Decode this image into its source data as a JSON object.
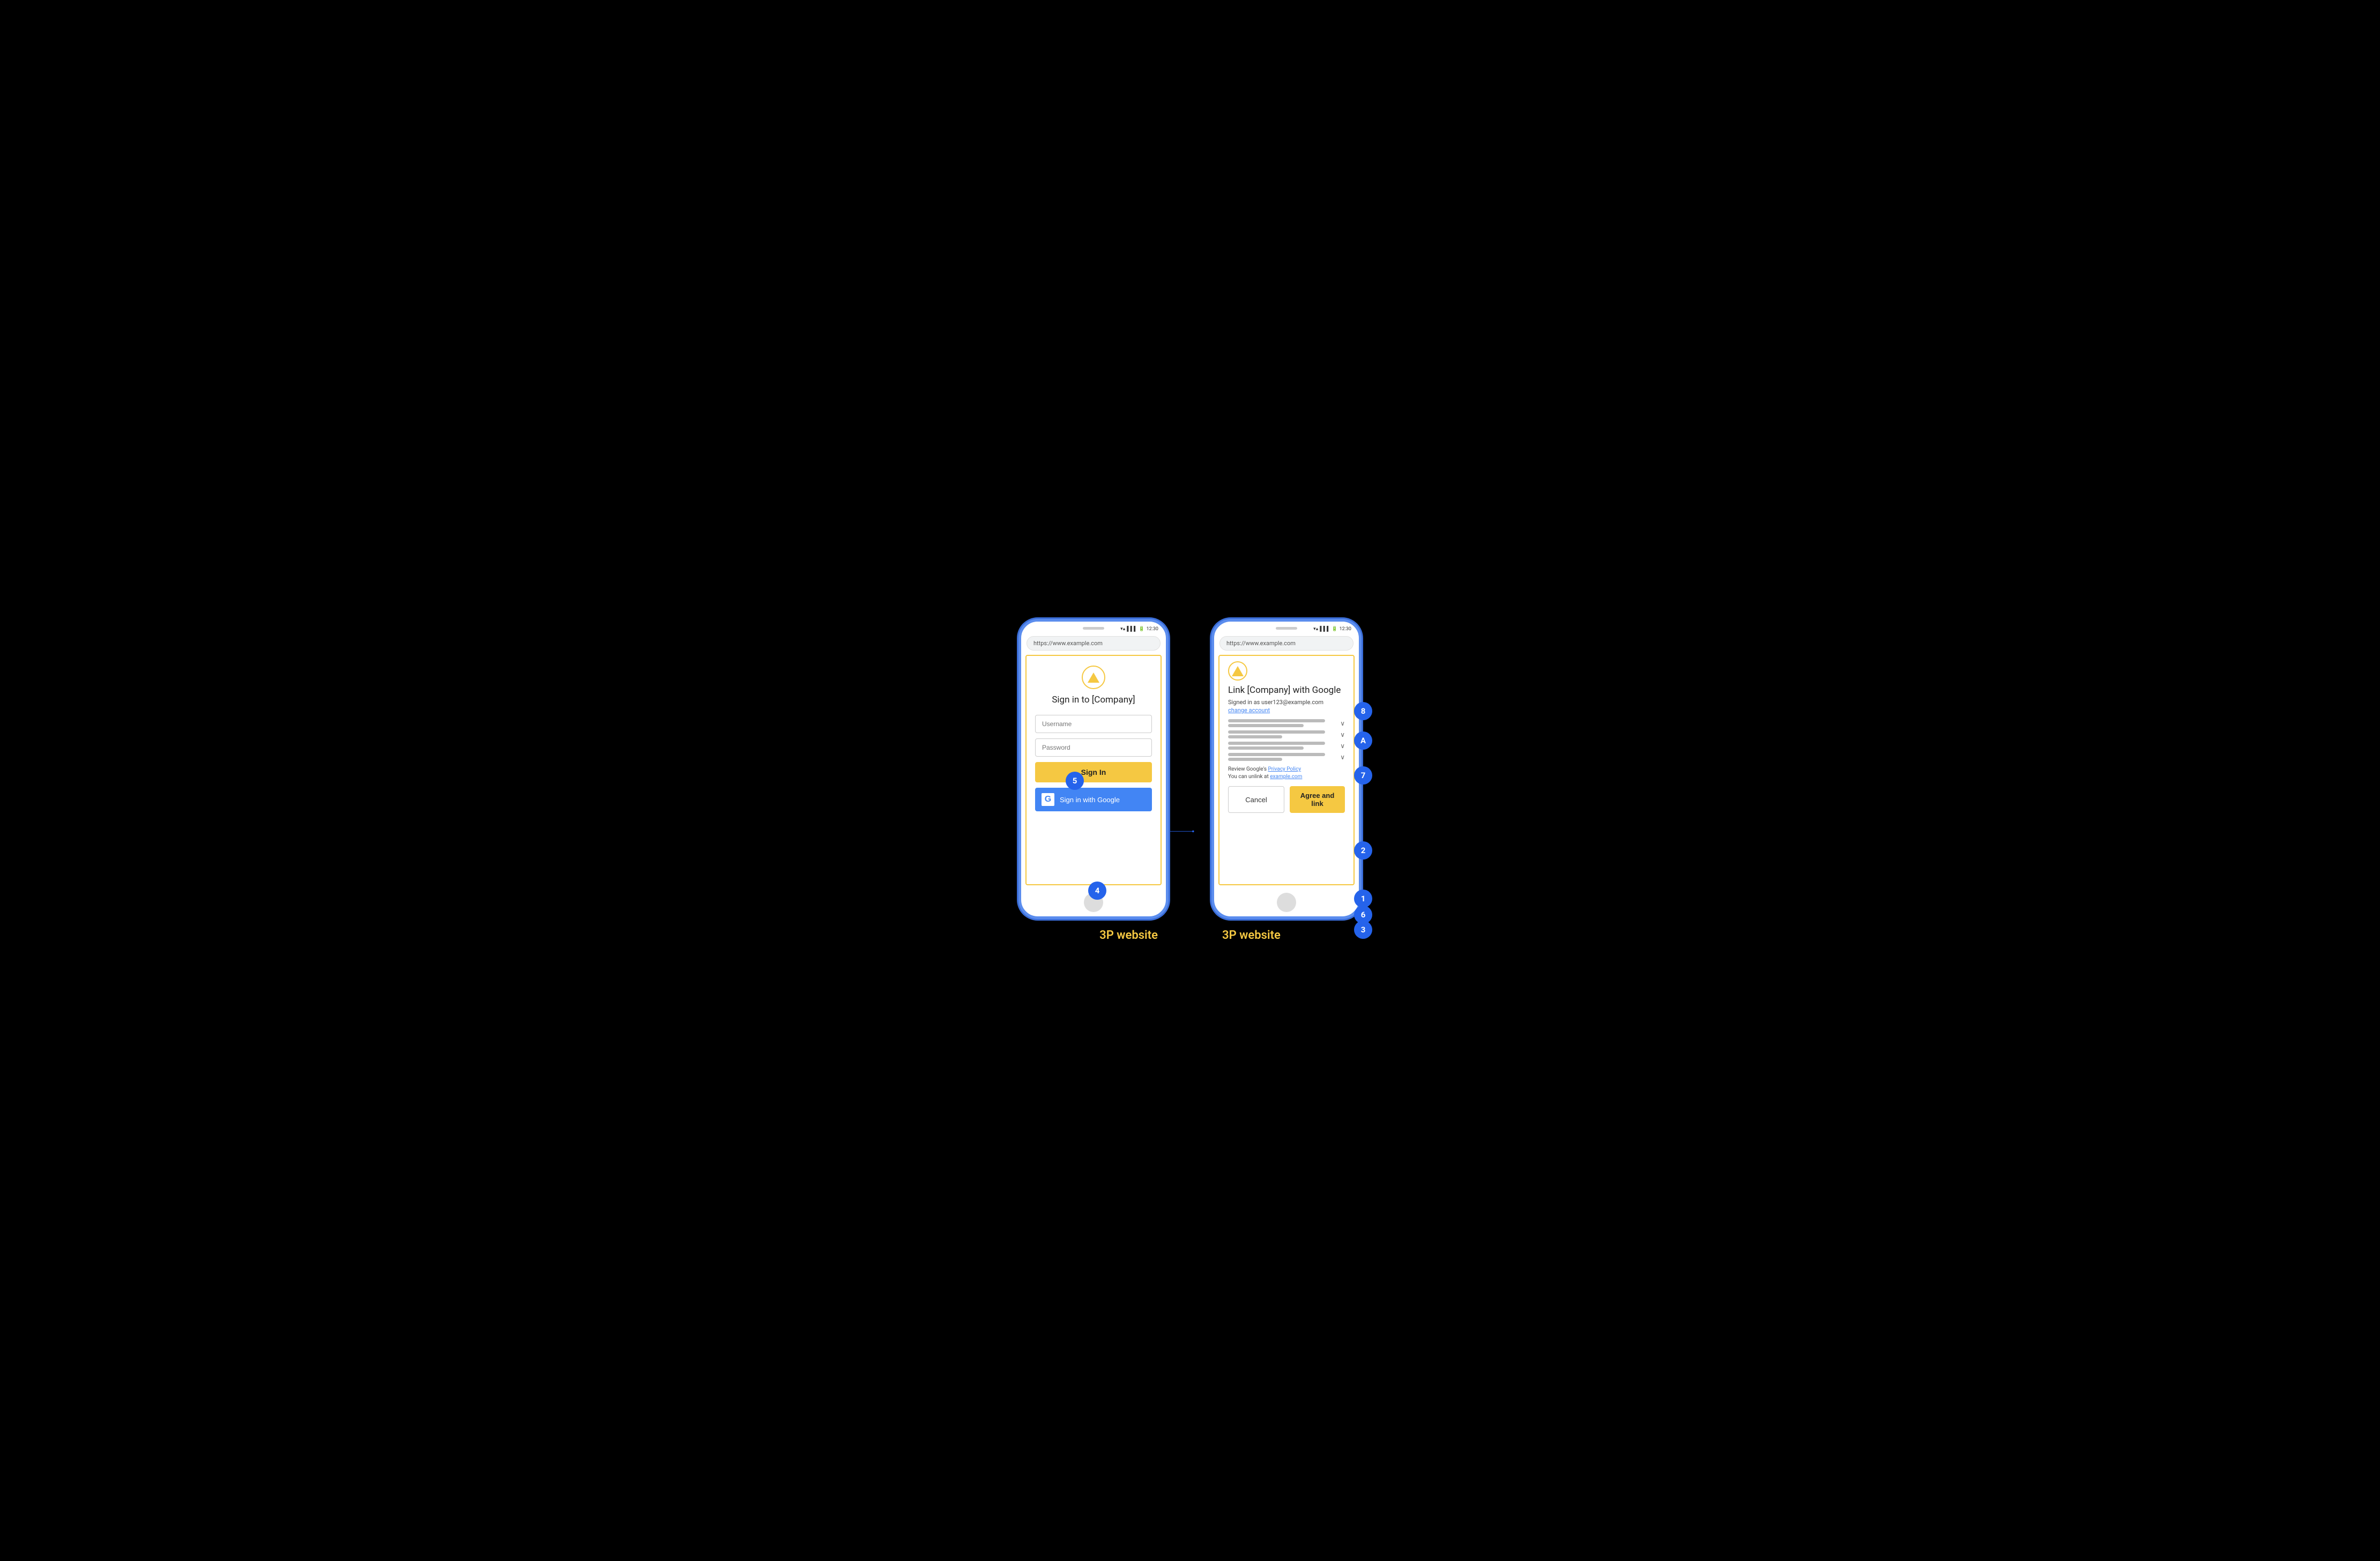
{
  "diagram": {
    "background": "#000000",
    "phones": [
      {
        "id": "left-phone",
        "label": "3P website",
        "status_time": "12:30",
        "url": "https://www.example.com",
        "content": {
          "type": "signin",
          "title": "Sign in to [Company]",
          "username_placeholder": "Username",
          "password_placeholder": "Password",
          "sign_in_btn": "Sign In",
          "google_btn": "Sign in with Google"
        }
      },
      {
        "id": "right-phone",
        "label": "3P website",
        "status_time": "12:30",
        "url": "https://www.example.com",
        "content": {
          "type": "link",
          "title": "Link [Company] with Google",
          "signed_in_as": "Signed in as user123@example.com",
          "change_account": "change account",
          "policy_text": "Review Google's",
          "policy_link": "Privacy Policy",
          "unlink_text": "You can unlink at",
          "unlink_link": "example.com",
          "cancel_btn": "Cancel",
          "agree_btn": "Agree and link"
        }
      }
    ],
    "annotations": [
      {
        "id": "1",
        "label": "1"
      },
      {
        "id": "2",
        "label": "2"
      },
      {
        "id": "3",
        "label": "3"
      },
      {
        "id": "4",
        "label": "4"
      },
      {
        "id": "5",
        "label": "5"
      },
      {
        "id": "6",
        "label": "6"
      },
      {
        "id": "7",
        "label": "7"
      },
      {
        "id": "8",
        "label": "8"
      },
      {
        "id": "A",
        "label": "A"
      }
    ]
  }
}
